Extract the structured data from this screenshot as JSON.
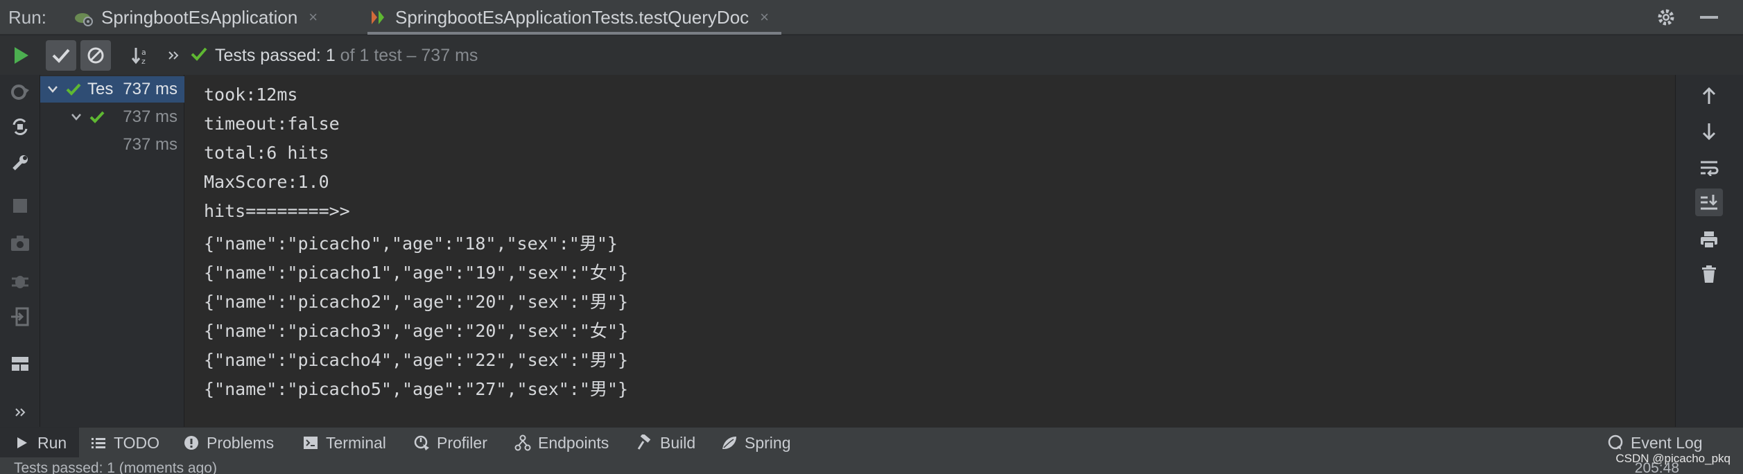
{
  "header": {
    "run_label": "Run:",
    "tabs": [
      {
        "label": "SpringbootEsApplication",
        "icon": "spring-app-icon",
        "close": "×",
        "active": false
      },
      {
        "label": "SpringbootEsApplicationTests.testQueryDoc",
        "icon": "test-run-icon",
        "close": "×",
        "active": true
      }
    ]
  },
  "toolbar": {
    "status_prefix": "Tests passed:",
    "passed": "1",
    "status_suffix": "of 1 test – 737 ms"
  },
  "tree": {
    "rows": [
      {
        "name": "Tes",
        "duration": "737 ms",
        "selected": true
      },
      {
        "name": "",
        "duration": "737 ms",
        "selected": false
      },
      {
        "name": "",
        "duration": "737 ms",
        "selected": false
      }
    ]
  },
  "console": {
    "lines": [
      "took:12ms",
      "timeout:false",
      "total:6 hits",
      "MaxScore:1.0",
      "hits========>>",
      "{\"name\":\"picacho\",\"age\":\"18\",\"sex\":\"男\"}",
      "{\"name\":\"picacho1\",\"age\":\"19\",\"sex\":\"女\"}",
      "{\"name\":\"picacho2\",\"age\":\"20\",\"sex\":\"男\"}",
      "{\"name\":\"picacho3\",\"age\":\"20\",\"sex\":\"女\"}",
      "{\"name\":\"picacho4\",\"age\":\"22\",\"sex\":\"男\"}",
      "{\"name\":\"picacho5\",\"age\":\"27\",\"sex\":\"男\"}"
    ]
  },
  "toolwindows": {
    "items": [
      {
        "label": "Run",
        "icon": "play-icon",
        "active": true
      },
      {
        "label": "TODO",
        "icon": "list-icon",
        "active": false
      },
      {
        "label": "Problems",
        "icon": "info-icon",
        "active": false
      },
      {
        "label": "Terminal",
        "icon": "terminal-icon",
        "active": false
      },
      {
        "label": "Profiler",
        "icon": "profiler-icon",
        "active": false
      },
      {
        "label": "Endpoints",
        "icon": "endpoints-icon",
        "active": false
      },
      {
        "label": "Build",
        "icon": "hammer-icon",
        "active": false
      },
      {
        "label": "Spring",
        "icon": "spring-leaf-icon",
        "active": false
      }
    ],
    "event_log": "Event Log"
  },
  "statusbar": {
    "message": "Tests passed: 1 (moments ago)",
    "time": "205:48"
  },
  "watermark": "CSDN @picacho_pkq",
  "colors": {
    "pass_green": "#5fb832",
    "run_green": "#4caf50",
    "selection": "#2f4d74"
  }
}
